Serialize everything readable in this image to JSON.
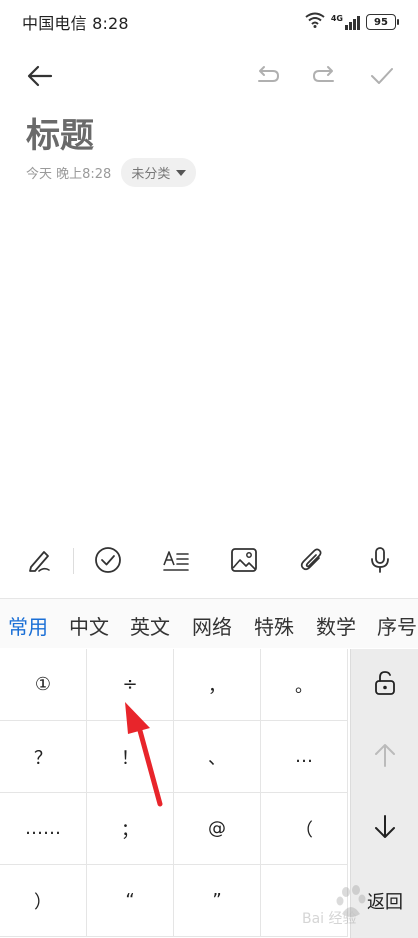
{
  "status_bar": {
    "carrier_time": "中国电信 8:28",
    "network_label": "4G",
    "battery": "95",
    "icons": [
      "wifi-icon",
      "signal-icon",
      "battery-icon"
    ]
  },
  "toolbar": {
    "icons": [
      "back-arrow-icon",
      "undo-icon",
      "redo-icon",
      "check-icon"
    ]
  },
  "note": {
    "title": "标题",
    "time": "今天 晚上8:28",
    "category": "未分类"
  },
  "format_toolbar": {
    "icons": [
      "pen-icon",
      "checklist-icon",
      "text-format-icon",
      "image-icon",
      "attachment-icon",
      "microphone-icon"
    ]
  },
  "keyboard": {
    "tabs": [
      "常用",
      "中文",
      "英文",
      "网络",
      "特殊",
      "数学",
      "序号"
    ],
    "active_tab": "常用",
    "keys": [
      [
        "①",
        "÷",
        "，",
        "。"
      ],
      [
        "？",
        "！",
        "、",
        "…"
      ],
      [
        "……",
        "；",
        "@",
        "（"
      ],
      [
        "）",
        "“",
        "”",
        ""
      ]
    ],
    "side": {
      "lock_icon": "unlock-icon",
      "up_icon": "arrow-up-icon",
      "down_icon": "arrow-down-icon",
      "back_label": "返回"
    }
  },
  "watermark": {
    "text": "Bai 经验"
  },
  "colors": {
    "accent": "#1a6fd6",
    "annotation": "#e8252b"
  }
}
